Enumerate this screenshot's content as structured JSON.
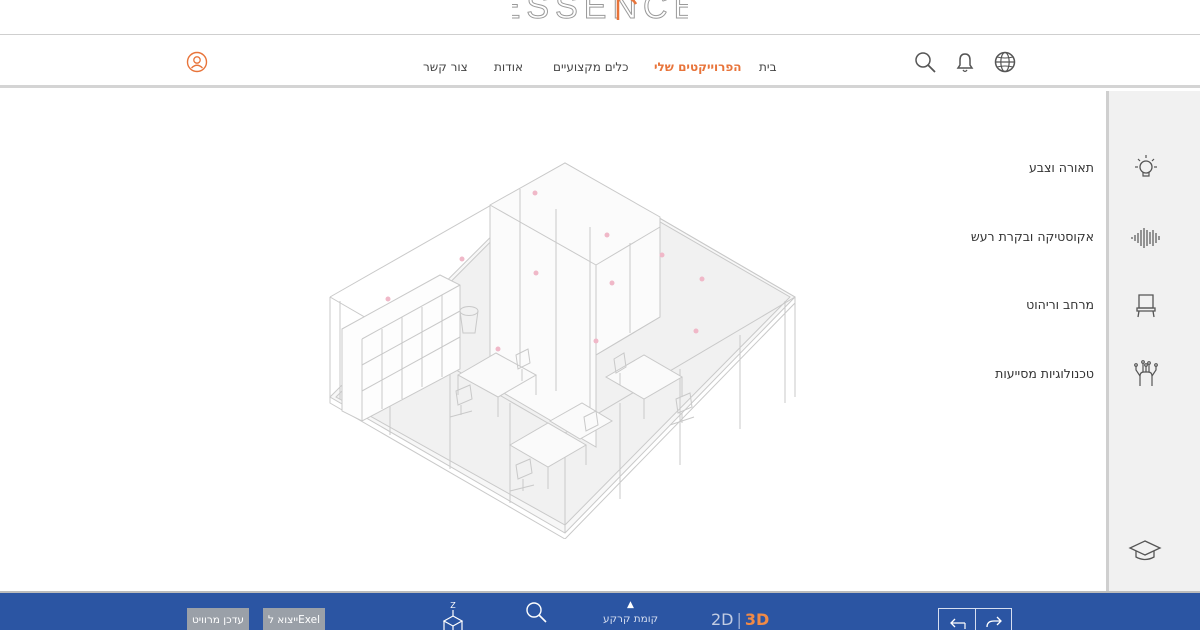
{
  "brand": {
    "logo_text": "ESSENCE"
  },
  "nav": {
    "links": [
      {
        "label": "בית"
      },
      {
        "label": "הפרוייקטים שלי"
      },
      {
        "label": "כלים מקצועיים"
      },
      {
        "label": "אודות"
      },
      {
        "label": "צור קשר"
      }
    ],
    "active_index": 1,
    "icons": [
      "search-icon",
      "bell-icon",
      "globe-icon",
      "user-icon"
    ]
  },
  "sidebar": {
    "categories": [
      {
        "label": "תאורה וצבע",
        "icon": "lightbulb-icon"
      },
      {
        "label": "אקוסטיקה ובקרת רעש",
        "icon": "sound-wave-icon"
      },
      {
        "label": "מרחב וריהוט",
        "icon": "chair-icon"
      },
      {
        "label": "טכנולוגיות מסייעות",
        "icon": "circuit-hand-icon"
      }
    ],
    "bottom_icon": "graduation-cap-icon"
  },
  "toolbar": {
    "update_project": "עדכן מרוויט",
    "export_excel": "ייצוא לExel",
    "axis_label": "Z",
    "floor_label": "קומת קרקע",
    "view_2d": "2D",
    "view_separator": "|",
    "view_3d": "3D",
    "active_view": "3D"
  },
  "colors": {
    "accent": "#e8743a",
    "toolbar_bg": "#2b55a3",
    "button_bg": "#9aa0a8",
    "sidebar_bg": "#f1f1f1"
  }
}
